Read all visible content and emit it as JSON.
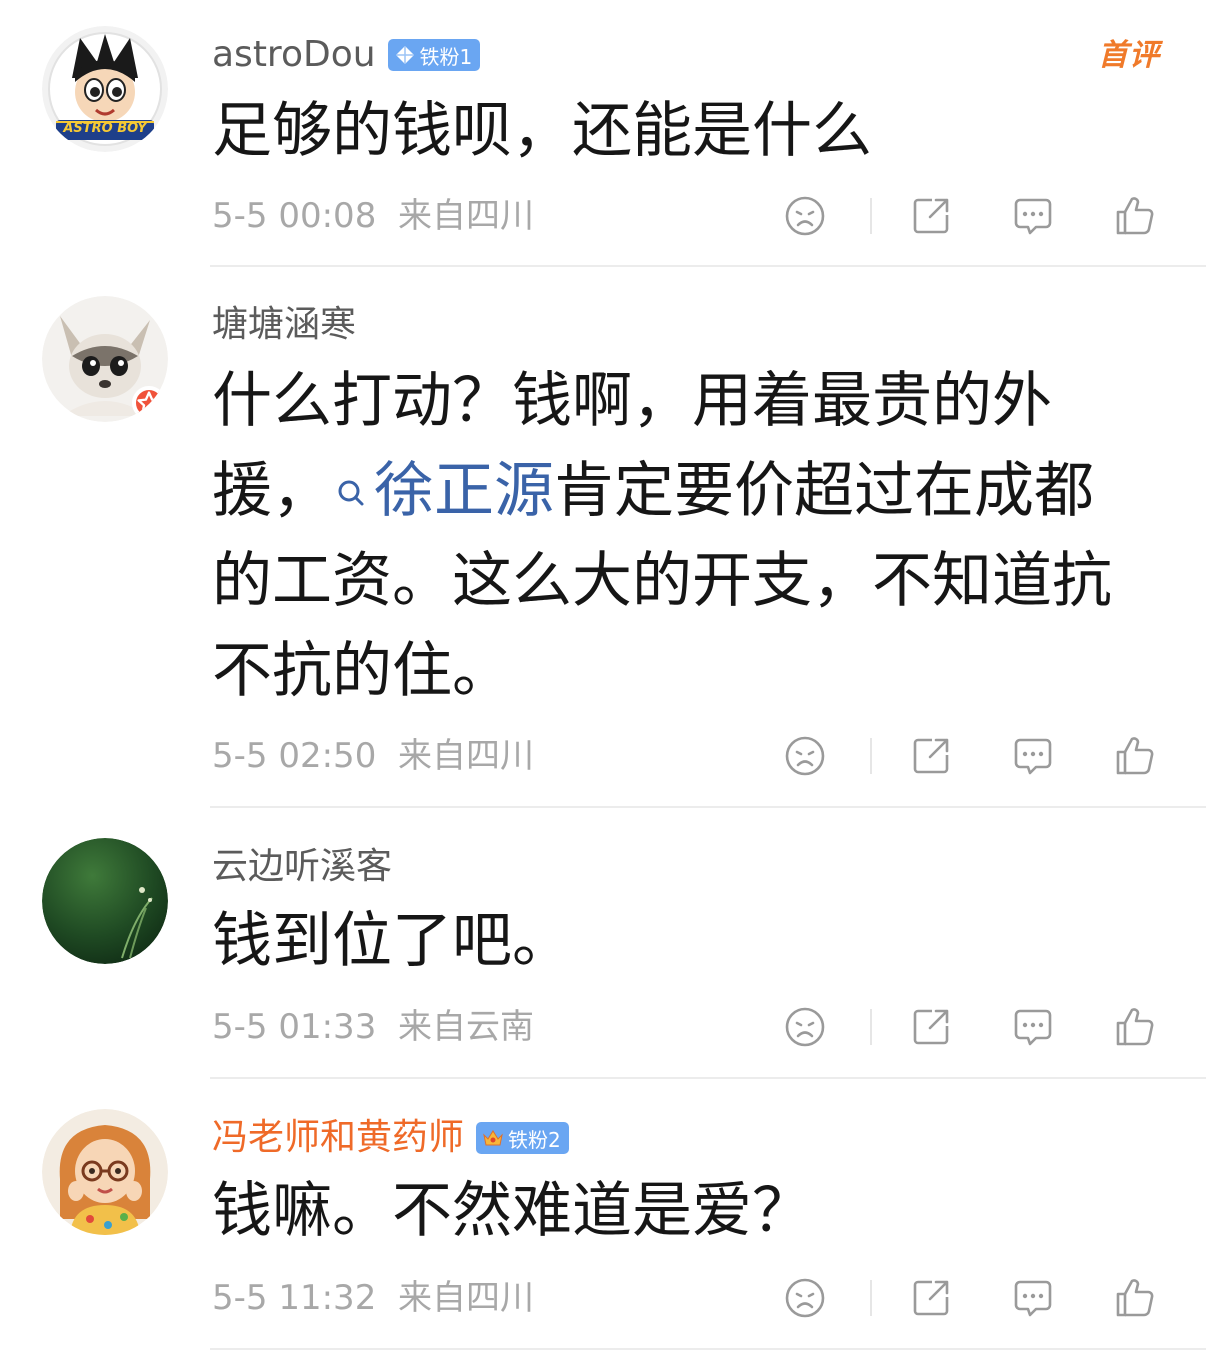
{
  "comments": [
    {
      "username": "astroDou",
      "fan_badge": "铁粉1",
      "first_tag": "首评",
      "text": "足够的钱呗，还能是什么",
      "time": "5-5 00:08",
      "location": "来自四川"
    },
    {
      "username": "塘塘涵寒",
      "text_before": "什么打动？钱啊，用着最贵的外援，",
      "mention": "徐正源",
      "text_after": "肯定要价超过在成都的工资。这么大的开支，不知道抗不抗的住。",
      "time": "5-5 02:50",
      "location": "来自四川"
    },
    {
      "username": "云边听溪客",
      "text": "钱到位了吧。",
      "time": "5-5 01:33",
      "location": "来自云南"
    },
    {
      "username": "冯老师和黄药师",
      "fan_badge": "铁粉2",
      "text": "钱嘛。不然难道是爱？",
      "time": "5-5 11:32",
      "location": "来自四川"
    }
  ],
  "avatar_logo_text": "ASTRO BOY",
  "icons": [
    "dislike-icon",
    "share-icon",
    "reply-icon",
    "like-icon",
    "search-icon",
    "diamond-icon",
    "crown-icon"
  ],
  "colors": {
    "vip_name": "#ef6a28",
    "mention": "#3a63a8",
    "badge": "#6aa6f2",
    "meta": "#a8a8a8"
  }
}
